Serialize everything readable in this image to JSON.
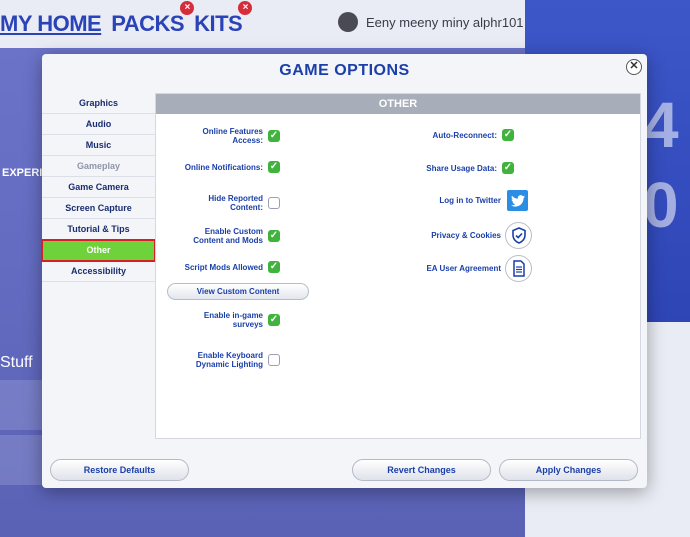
{
  "background": {
    "tabs": [
      {
        "label": "MY HOME"
      },
      {
        "label": "PACKS",
        "badge": "×"
      },
      {
        "label": "KITS",
        "badge": "×"
      }
    ],
    "user_name": "Eeny meeny miny alphr101",
    "side_labels": [
      "EXPERI",
      "Stuff"
    ],
    "right_digits": [
      "4",
      "0"
    ]
  },
  "dialog": {
    "title": "GAME OPTIONS",
    "close_glyph": "✕",
    "nav": [
      {
        "label": "Graphics",
        "state": "normal"
      },
      {
        "label": "Audio",
        "state": "normal"
      },
      {
        "label": "Music",
        "state": "normal"
      },
      {
        "label": "Gameplay",
        "state": "disabled"
      },
      {
        "label": "Game Camera",
        "state": "normal"
      },
      {
        "label": "Screen Capture",
        "state": "normal"
      },
      {
        "label": "Tutorial & Tips",
        "state": "normal"
      },
      {
        "label": "Other",
        "state": "active"
      },
      {
        "label": "Accessibility",
        "state": "normal"
      }
    ],
    "section_header": "OTHER",
    "left_options": [
      {
        "label_line1": "Online Features",
        "label_line2": "Access:",
        "checked": true
      },
      {
        "label_line1": "Online Notifications:",
        "label_line2": "",
        "checked": true
      },
      {
        "label_line1": "Hide Reported",
        "label_line2": "Content:",
        "checked": false
      },
      {
        "label_line1": "Enable Custom",
        "label_line2": "Content and Mods",
        "checked": true
      },
      {
        "label_line1": "Script Mods Allowed",
        "label_line2": "",
        "checked": true
      },
      {
        "label_line1": "Enable in-game",
        "label_line2": "surveys",
        "checked": true
      },
      {
        "label_line1": "Enable Keyboard",
        "label_line2": "Dynamic Lighting",
        "checked": false
      }
    ],
    "view_custom_content": "View Custom Content",
    "right_options": {
      "auto_reconnect": {
        "label": "Auto-Reconnect:",
        "checked": true
      },
      "share_usage": {
        "label": "Share Usage Data:",
        "checked": true
      },
      "twitter": {
        "label": "Log in to Twitter",
        "icon": "twitter-bird-icon"
      },
      "privacy": {
        "label": "Privacy & Cookies",
        "icon": "shield-check-icon"
      },
      "eula": {
        "label": "EA User Agreement",
        "icon": "document-icon"
      }
    },
    "footer": {
      "restore": "Restore Defaults",
      "revert": "Revert Changes",
      "apply": "Apply Changes"
    },
    "colors": {
      "accent": "#1a3fa8",
      "active_tab": "#6fd23a",
      "highlight_border": "#d61f26",
      "checkbox_on": "#3fb33c",
      "twitter": "#2a8fe4"
    }
  }
}
